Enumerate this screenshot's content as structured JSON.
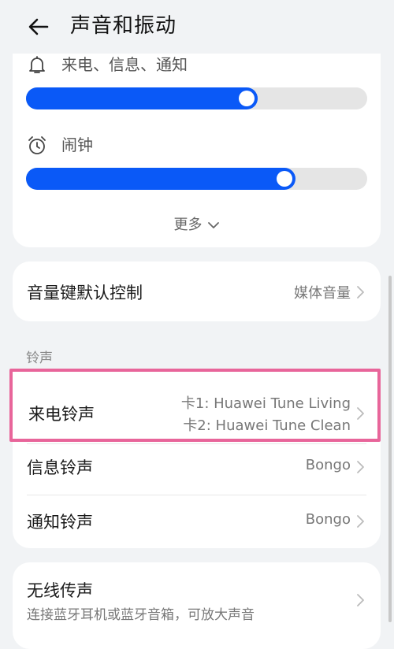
{
  "header": {
    "title": "声音和振动"
  },
  "volume": {
    "ringtone_label": "来电、信息、通知",
    "ringtone_level": 0.68,
    "alarm_label": "闹钟",
    "alarm_level": 0.79,
    "more_label": "更多"
  },
  "volume_key": {
    "label": "音量键默认控制",
    "value": "媒体音量"
  },
  "ringtones": {
    "section_title": "铃声",
    "incoming": {
      "label": "来电铃声",
      "card1": "卡1: Huawei Tune Living",
      "card2": "卡2: Huawei Tune Clean"
    },
    "message": {
      "label": "信息铃声",
      "value": "Bongo"
    },
    "notification": {
      "label": "通知铃声",
      "value": "Bongo"
    }
  },
  "wireless": {
    "label": "无线传声",
    "desc": "连接蓝牙耳机或蓝牙音箱，可放大声音"
  },
  "colors": {
    "accent": "#0a59f7",
    "highlight": "#e8659a"
  }
}
